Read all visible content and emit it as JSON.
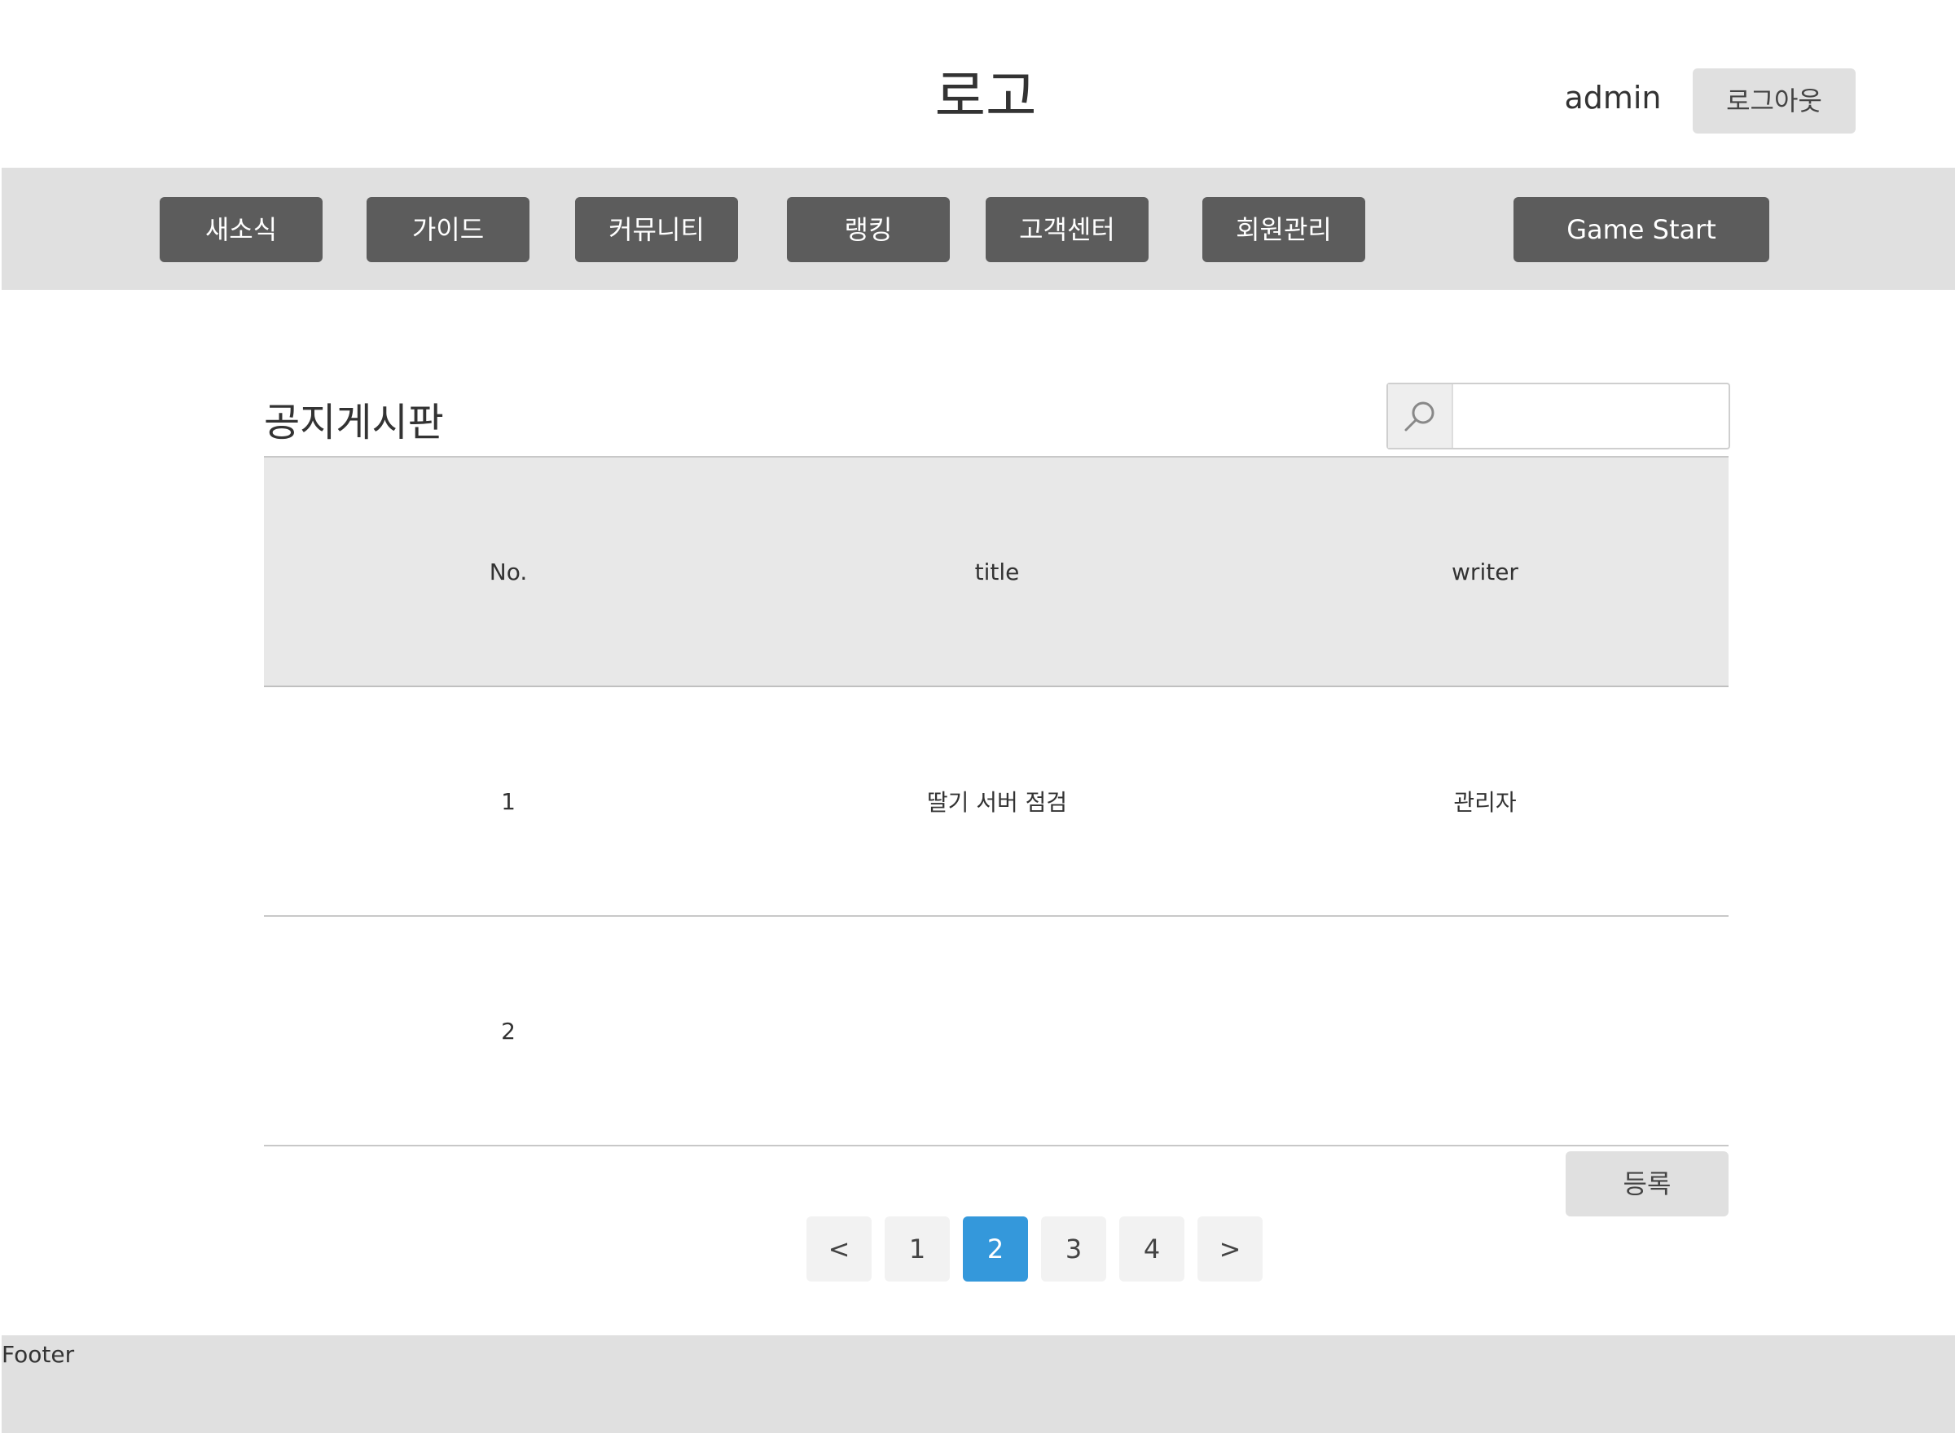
{
  "header": {
    "logo": "로고",
    "user_name": "admin",
    "logout_label": "로그아웃"
  },
  "nav": {
    "items": [
      "새소식",
      "가이드",
      "커뮤니티",
      "랭킹",
      "고객센터",
      "회원관리"
    ],
    "game_start_label": "Game Start"
  },
  "board": {
    "title": "공지게시판",
    "search": {
      "placeholder": "",
      "value": ""
    },
    "columns": [
      "No.",
      "title",
      "writer"
    ],
    "rows": [
      {
        "no": "1",
        "title": "딸기 서버 점검",
        "writer": "관리자"
      },
      {
        "no": "2",
        "title": "",
        "writer": ""
      }
    ],
    "register_label": "등록"
  },
  "pagination": {
    "prev_label": "<",
    "pages": [
      "1",
      "2",
      "3",
      "4"
    ],
    "current_page": "2",
    "next_label": ">"
  },
  "footer": {
    "text": "Footer"
  },
  "colors": {
    "nav_bg": "#e0e0e0",
    "nav_button": "#5c5c5c",
    "active_page": "#3498db",
    "table_header_bg": "#e8e8e8"
  }
}
